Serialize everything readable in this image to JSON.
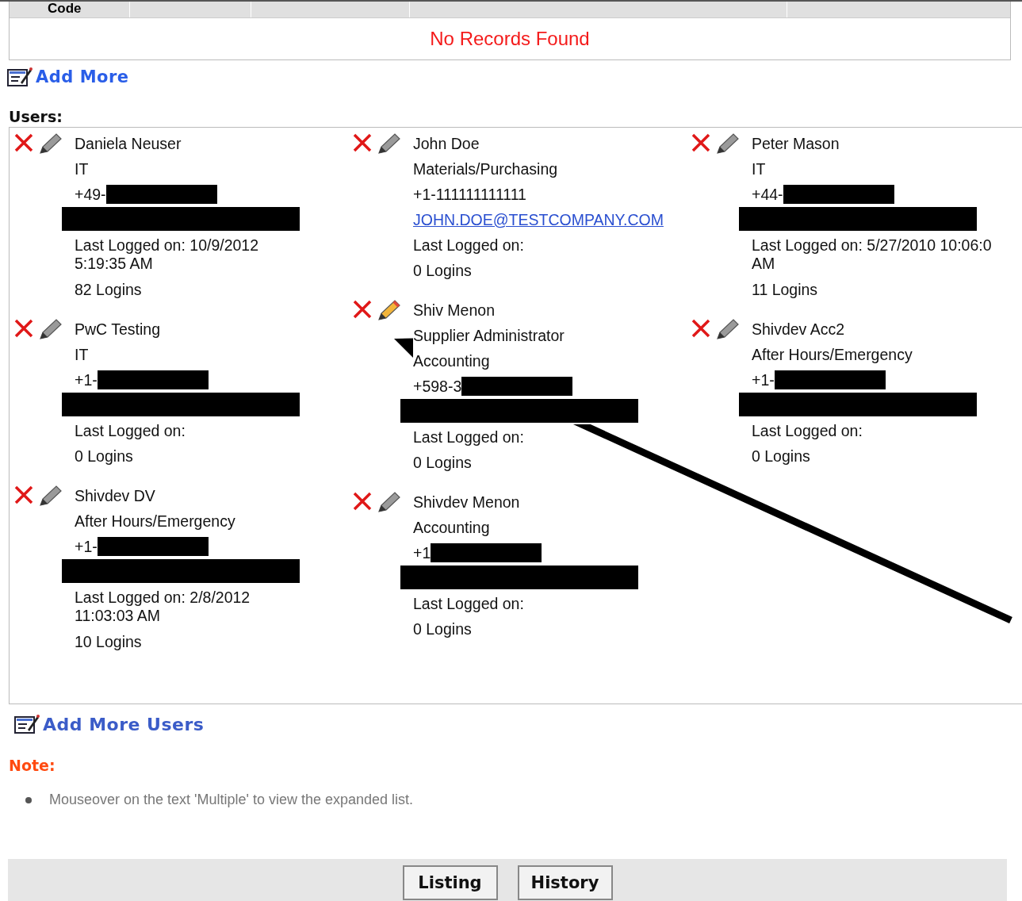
{
  "records_table": {
    "columns": [
      "Code"
    ],
    "empty_message": "No Records Found"
  },
  "add_more_link": "Add More",
  "users_label": "Users:",
  "user_columns": [
    [
      {
        "name": "Daniela Neuser",
        "edit_highlighted": false,
        "lines": [
          {
            "kind": "text",
            "text": "IT"
          },
          {
            "kind": "redacted_after",
            "text": "+49-"
          },
          {
            "kind": "redacted"
          },
          {
            "kind": "text",
            "text": "Last Logged on: 10/9/2012"
          },
          {
            "kind": "cont",
            "text": "5:19:35 AM"
          },
          {
            "kind": "text",
            "text": "82 Logins"
          }
        ]
      },
      {
        "name": "PwC Testing",
        "edit_highlighted": false,
        "lines": [
          {
            "kind": "text",
            "text": "IT"
          },
          {
            "kind": "redacted_after",
            "text": "+1-"
          },
          {
            "kind": "redacted"
          },
          {
            "kind": "text",
            "text": "Last Logged on:"
          },
          {
            "kind": "text",
            "text": "0 Logins"
          }
        ]
      },
      {
        "name": "Shivdev DV",
        "edit_highlighted": false,
        "lines": [
          {
            "kind": "text",
            "text": "After Hours/Emergency"
          },
          {
            "kind": "redacted_after",
            "text": "+1-"
          },
          {
            "kind": "redacted"
          },
          {
            "kind": "text",
            "text": "Last Logged on: 2/8/2012"
          },
          {
            "kind": "cont",
            "text": "11:03:03 AM"
          },
          {
            "kind": "text",
            "text": "10 Logins"
          }
        ]
      }
    ],
    [
      {
        "name": "John Doe",
        "edit_highlighted": false,
        "lines": [
          {
            "kind": "text",
            "text": "Materials/Purchasing"
          },
          {
            "kind": "text",
            "text": "+1-111111111111"
          },
          {
            "kind": "link",
            "text": "JOHN.DOE@TESTCOMPANY.COM"
          },
          {
            "kind": "text",
            "text": "Last Logged on:"
          },
          {
            "kind": "text",
            "text": "0 Logins"
          }
        ]
      },
      {
        "name": "Shiv Menon",
        "edit_highlighted": true,
        "lines": [
          {
            "kind": "text",
            "text": "Supplier Administrator"
          },
          {
            "kind": "text",
            "text": "Accounting"
          },
          {
            "kind": "redacted_after",
            "text": "+598-3"
          },
          {
            "kind": "redacted"
          },
          {
            "kind": "text",
            "text": "Last Logged on:"
          },
          {
            "kind": "text",
            "text": "0 Logins"
          }
        ]
      },
      {
        "name": "Shivdev Menon",
        "edit_highlighted": false,
        "lines": [
          {
            "kind": "text",
            "text": "Accounting"
          },
          {
            "kind": "redacted_after",
            "text": "+1"
          },
          {
            "kind": "redacted"
          },
          {
            "kind": "text",
            "text": "Last Logged on:"
          },
          {
            "kind": "text",
            "text": "0 Logins"
          }
        ]
      }
    ],
    [
      {
        "name": "Peter Mason",
        "edit_highlighted": false,
        "lines": [
          {
            "kind": "text",
            "text": "IT"
          },
          {
            "kind": "redacted_after",
            "text": "+44-"
          },
          {
            "kind": "redacted"
          },
          {
            "kind": "text",
            "text": "Last Logged on: 5/27/2010 10:06:0"
          },
          {
            "kind": "cont",
            "text": "AM"
          },
          {
            "kind": "text",
            "text": "11 Logins"
          }
        ]
      },
      {
        "name": "Shivdev Acc2",
        "edit_highlighted": false,
        "lines": [
          {
            "kind": "text",
            "text": "After Hours/Emergency"
          },
          {
            "kind": "redacted_after",
            "text": "+1-"
          },
          {
            "kind": "redacted"
          },
          {
            "kind": "text",
            "text": "Last Logged on:"
          },
          {
            "kind": "text",
            "text": "0 Logins"
          }
        ]
      }
    ]
  ],
  "add_more_users_link": "Add More Users",
  "note_label": "Note:",
  "notes": [
    "Mouseover on the text 'Multiple' to view the expanded list."
  ],
  "buttons": [
    "Listing",
    "History"
  ],
  "arrow_annotation": true
}
